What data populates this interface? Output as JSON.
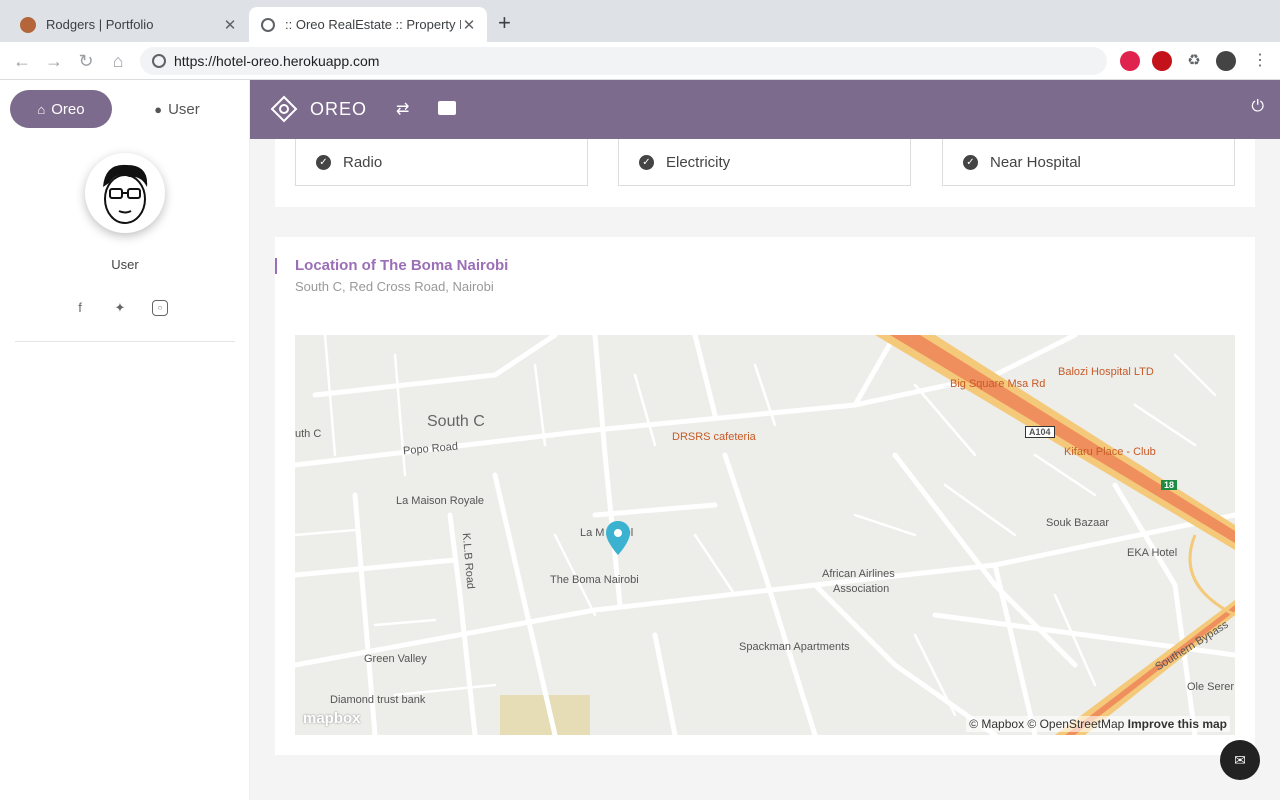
{
  "browser": {
    "tabs": [
      {
        "title": "Rodgers | Portfolio",
        "active": false
      },
      {
        "title": ":: Oreo RealEstate :: Property D",
        "active": true
      }
    ],
    "close_glyph": "✕",
    "new_tab_glyph": "+",
    "url": "https://hotel-oreo.herokuapp.com",
    "extensions": [
      "adblock-icon",
      "ublock-icon",
      "puzzle-icon",
      "profile-avatar"
    ]
  },
  "sidebar": {
    "tabs": [
      {
        "label": "Oreo",
        "icon": "home-icon"
      },
      {
        "label": "User",
        "icon": "user-icon"
      }
    ],
    "username": "User",
    "socials": [
      "facebook-icon",
      "twitter-icon",
      "instagram-icon"
    ]
  },
  "topbar": {
    "brand": "OREO",
    "icons": [
      "swap-icon",
      "contact-card-icon",
      "power-icon"
    ],
    "color": "#7d6b8e"
  },
  "amenities": [
    "Radio",
    "Electricity",
    "Near Hospital"
  ],
  "location": {
    "title": "Location of The Boma Nairobi",
    "address": "South C, Red Cross Road, Nairobi"
  },
  "map": {
    "labels": {
      "area_south_c": "South C",
      "area_south_c_cut": "uth C",
      "popo_road": "Popo Road",
      "klb_road": "K.L.B Road",
      "drsrs": "DRSRS cafeteria",
      "la_maison": "La Maison Royale",
      "la_mada": "La M     Hotel",
      "boma": "The Boma Nairobi",
      "big_square": "Big Square Msa Rd",
      "balozi": "Balozi Hospital LTD",
      "kifaru": "Kifaru Place - Club",
      "souk": "Souk Bazaar",
      "eka": "EKA Hotel",
      "african": "African Airlines",
      "african2": "Association",
      "spackman": "Spackman Apartments",
      "green_valley": "Green Valley",
      "diamond": "Diamond trust bank",
      "southern_bypass": "Southern Bypass",
      "ole": "Ole Serer",
      "a104": "A104",
      "r18": "18"
    },
    "logo": "mapbox",
    "attribution": "© Mapbox © OpenStreetMap",
    "improve": "Improve this map"
  },
  "chat_icon": "chat-icon"
}
